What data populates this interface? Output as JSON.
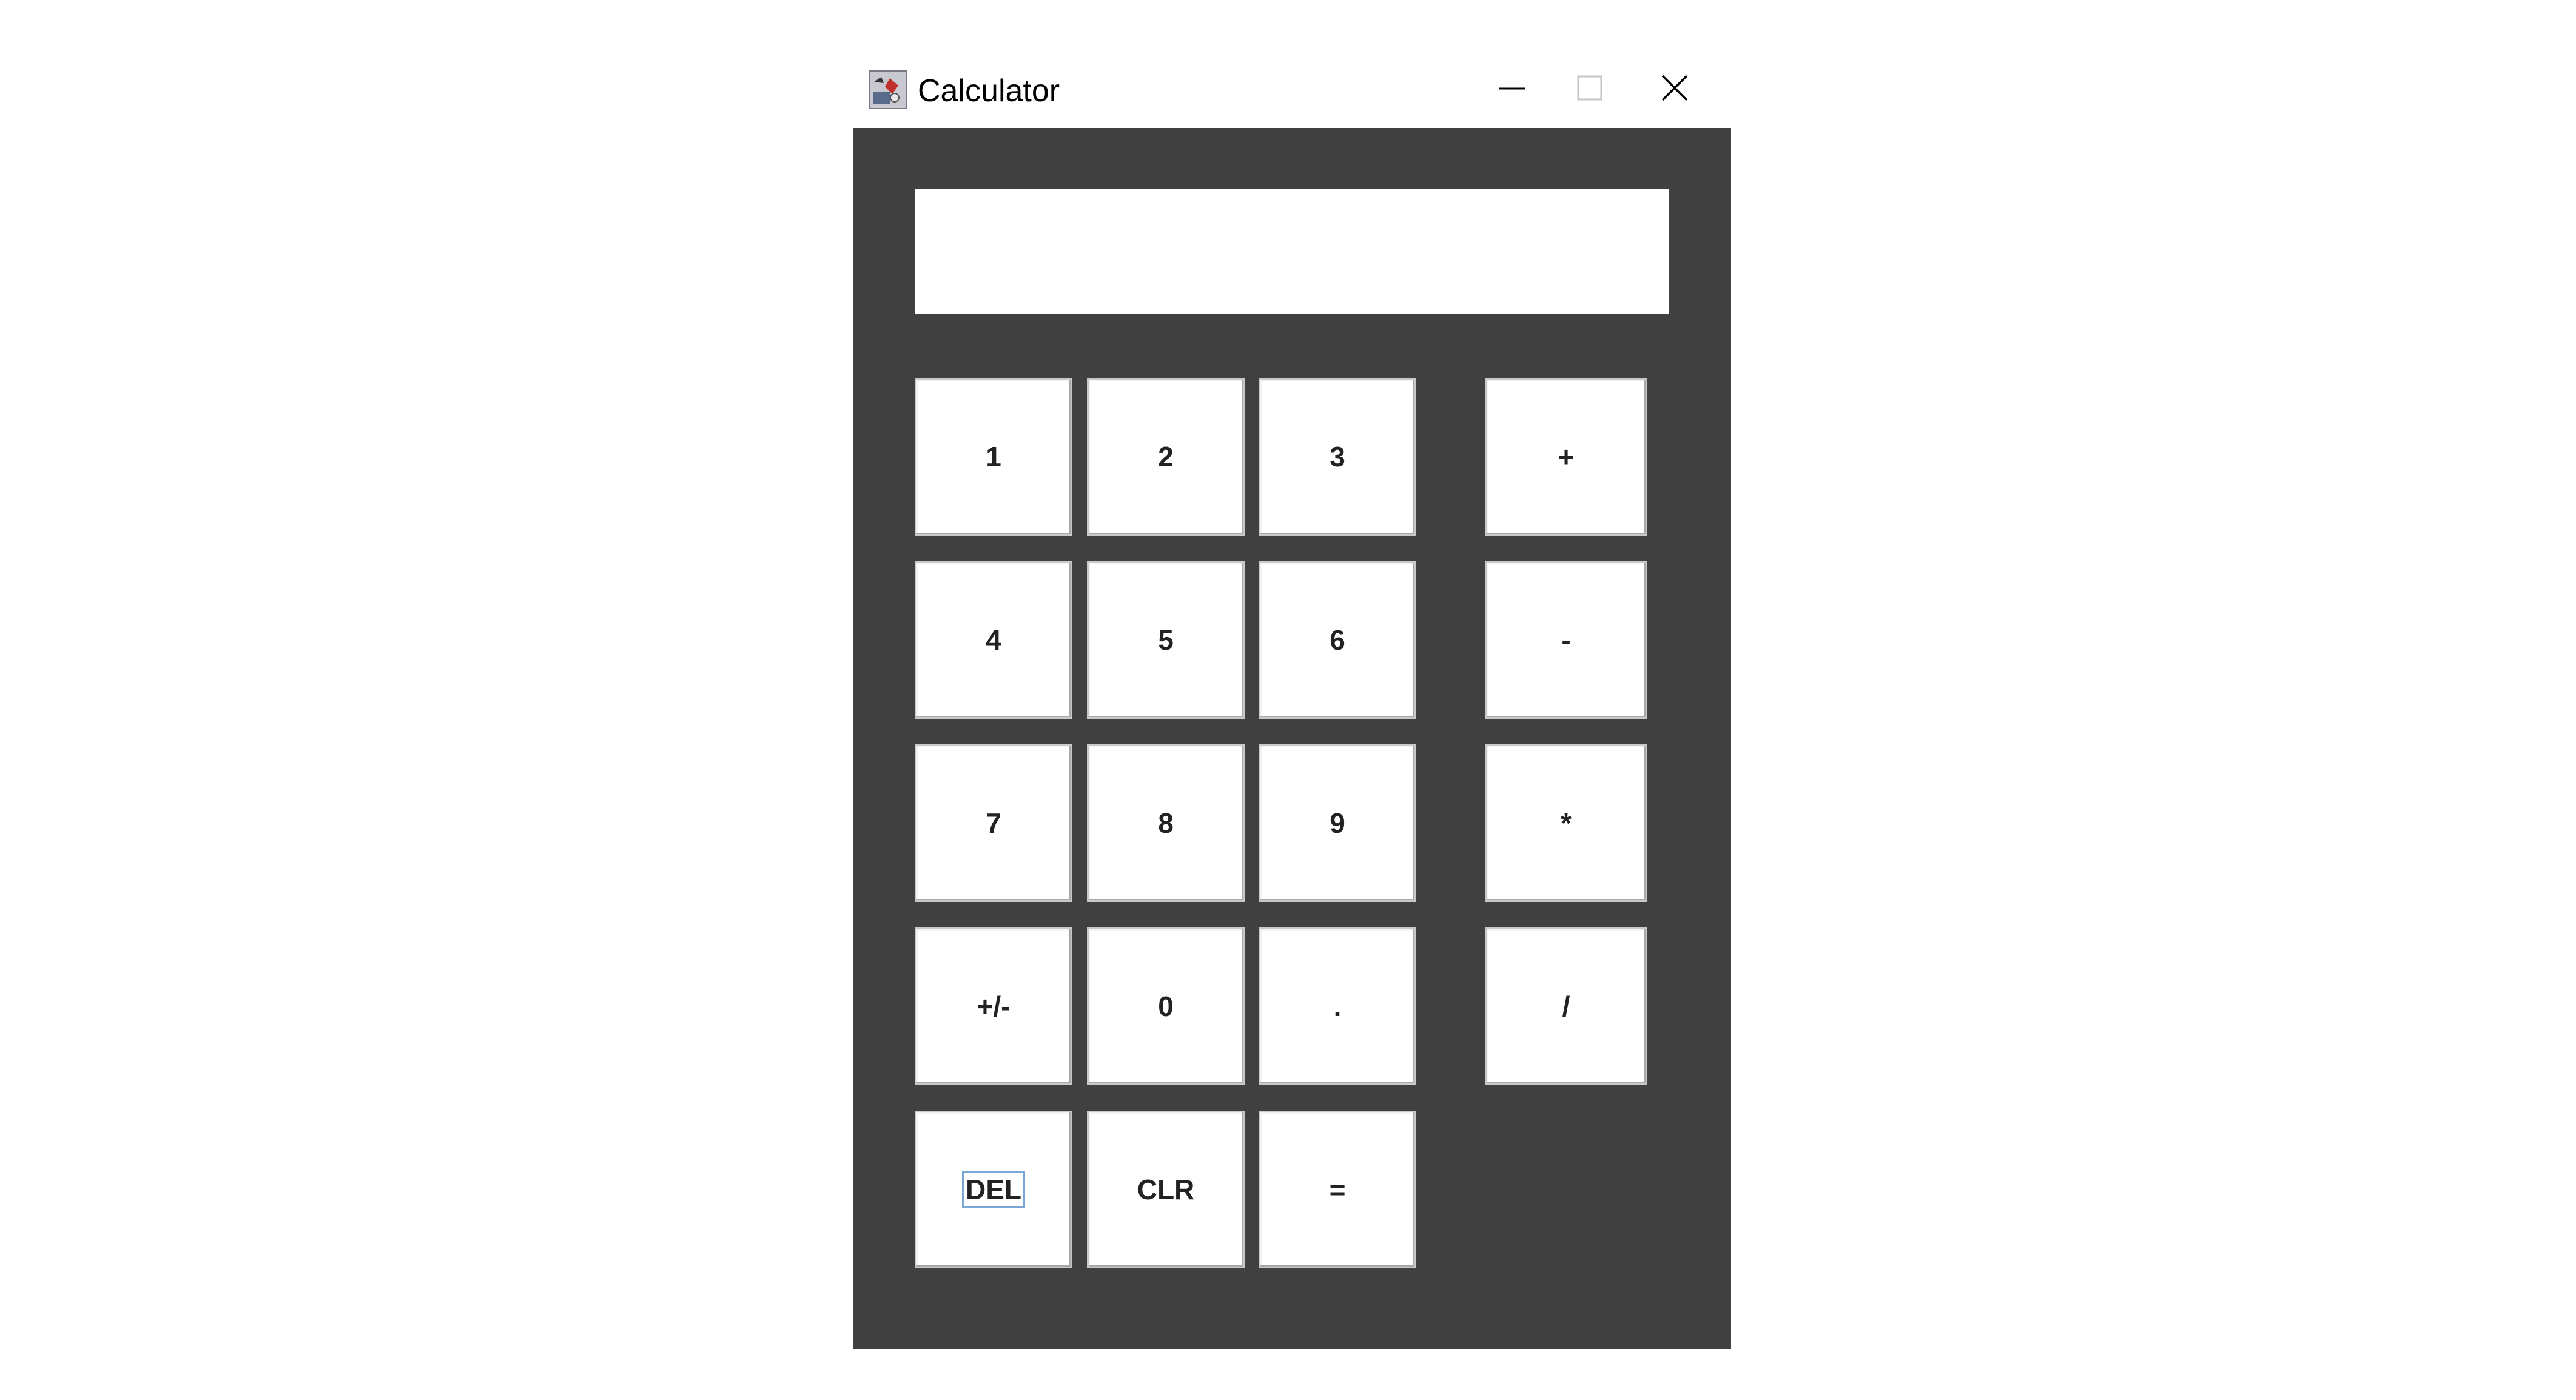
{
  "window": {
    "title": "Calculator",
    "icon": "java-cup-icon",
    "controls": {
      "minimize_icon": "minimize-icon",
      "maximize_icon": "maximize-icon",
      "close_icon": "close-icon"
    }
  },
  "display": {
    "value": ""
  },
  "keys": {
    "k1": "1",
    "k2": "2",
    "k3": "3",
    "plus": "+",
    "k4": "4",
    "k5": "5",
    "k6": "6",
    "minus": "-",
    "k7": "7",
    "k8": "8",
    "k9": "9",
    "multiply": "*",
    "negate": "+/-",
    "k0": "0",
    "decimal": ".",
    "divide": "/",
    "del": "DEL",
    "clr": "CLR",
    "equals": "="
  },
  "colors": {
    "panel_background": "#404040",
    "key_background": "#ffffff",
    "display_background": "#ffffff",
    "focus_ring": "#7aa7d6"
  }
}
